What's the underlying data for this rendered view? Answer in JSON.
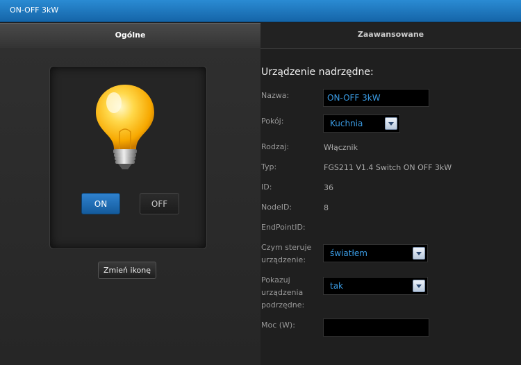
{
  "window": {
    "title": "ON-OFF 3kW"
  },
  "tabs": {
    "general": "Ogólne",
    "advanced": "Zaawansowane"
  },
  "icon_panel": {
    "icon": "light-bulb-icon",
    "on_label": "ON",
    "off_label": "OFF",
    "change_icon_label": "Zmień ikonę"
  },
  "device": {
    "section_title": "Urządzenie nadrzędne:",
    "name_label": "Nazwa:",
    "name_value": "ON-OFF 3kW",
    "room_label": "Pokój:",
    "room_value": "Kuchnia",
    "type_label": "Rodzaj:",
    "type_value": "Włącznik",
    "model_label": "Typ:",
    "model_value": "FGS211 V1.4 Switch ON OFF 3kW",
    "id_label": "ID:",
    "id_value": "36",
    "node_label": "NodeID:",
    "node_value": "8",
    "endpoint_label": "EndPointID:",
    "controls_label_1": "Czym steruje",
    "controls_label_2": "urządzenie:",
    "controls_value": "światłem",
    "show_label_1": "Pokazuj",
    "show_label_2": "urządzenia",
    "show_label_3": "podrzędne:",
    "show_value": "tak",
    "power_label": "Moc (W):",
    "power_value": ""
  },
  "colors": {
    "accent": "#1f7ac2",
    "field_text": "#3a9be3"
  }
}
